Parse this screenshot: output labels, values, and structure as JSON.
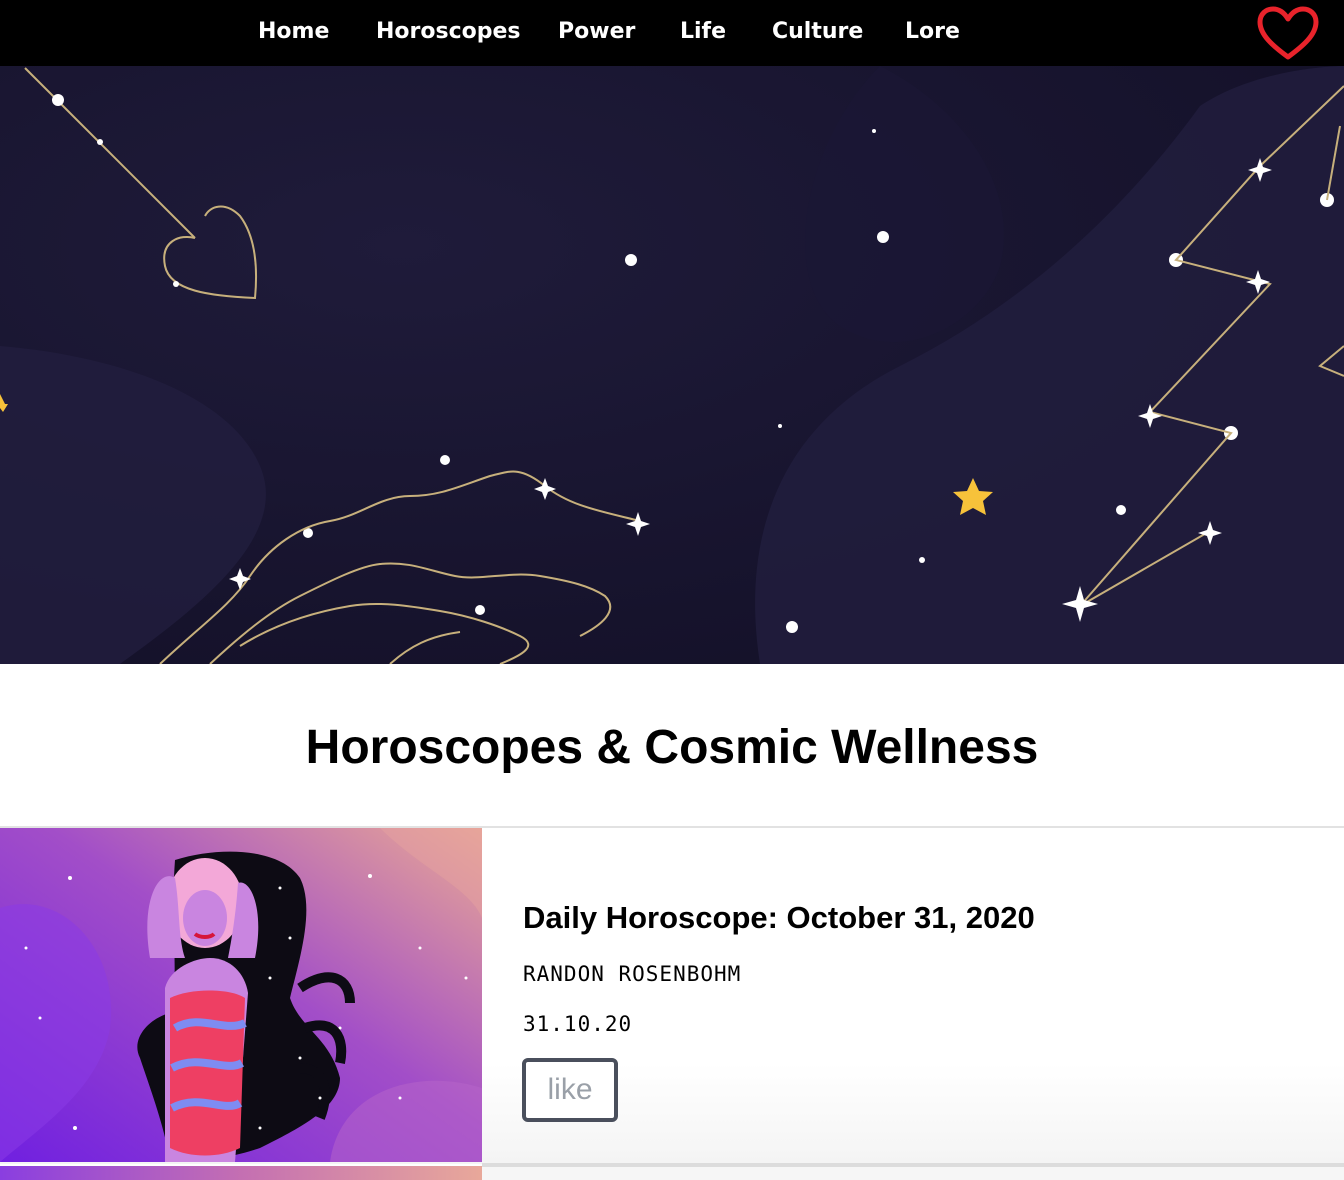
{
  "nav": {
    "items": [
      {
        "label": "Home"
      },
      {
        "label": "Horoscopes"
      },
      {
        "label": "Power"
      },
      {
        "label": "Life"
      },
      {
        "label": "Culture"
      },
      {
        "label": "Lore"
      }
    ],
    "favorites_icon": "heart-outline-icon"
  },
  "hero": {
    "background_color": "#17142d",
    "constellation_color": "#c7b07c",
    "star_accent_color": "#f7c23a"
  },
  "page": {
    "title": "Horoscopes & Cosmic Wellness"
  },
  "articles": [
    {
      "title": "Daily Horoscope: October 31, 2020",
      "author": "RANDON ROSENBOHM",
      "date": "31.10.20",
      "like_label": "like",
      "image_subject": "scorpio-illustration"
    }
  ],
  "colors": {
    "nav_background": "#000000",
    "nav_text": "#ffffff",
    "heart_accent": "#e8232b",
    "like_border": "#4a4f5c",
    "like_text": "#9aa0a8"
  }
}
